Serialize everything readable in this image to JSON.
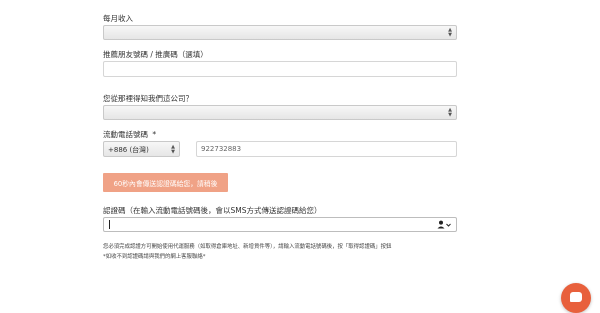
{
  "form": {
    "monthly_income": {
      "label": "每月收入",
      "value": ""
    },
    "referral": {
      "label": "推薦朋友號碼 / 推廣碼（選填）",
      "value": ""
    },
    "source": {
      "label": "您從那裡得知我們這公司？",
      "value": ""
    },
    "mobile": {
      "label": "流動電話號碼",
      "required": "*",
      "country_code": "+886 (台灣)",
      "number": "922732883"
    },
    "send_code_button": "60秒內會傳送認證碼給您，請稍後",
    "verification": {
      "label": "認證碼（在輸入流動電話號碼後，會以SMS方式傳送認證碼給您）",
      "value": ""
    },
    "notes": [
      "您必須完成認證方可開始使用代運服務（如取得倉庫地址、新增貨件等），請輸入流動電話號碼後，按「取得認證碼」按鈕",
      "*如收不到認證碼請與我們的網上客服聯絡*"
    ]
  },
  "icons": {
    "select_arrows": "updown-arrows-icon",
    "user_dropdown": "user-dropdown-icon",
    "chat": "chat-icon"
  },
  "colors": {
    "accent": "#f0a286",
    "chat": "#e8603c"
  }
}
